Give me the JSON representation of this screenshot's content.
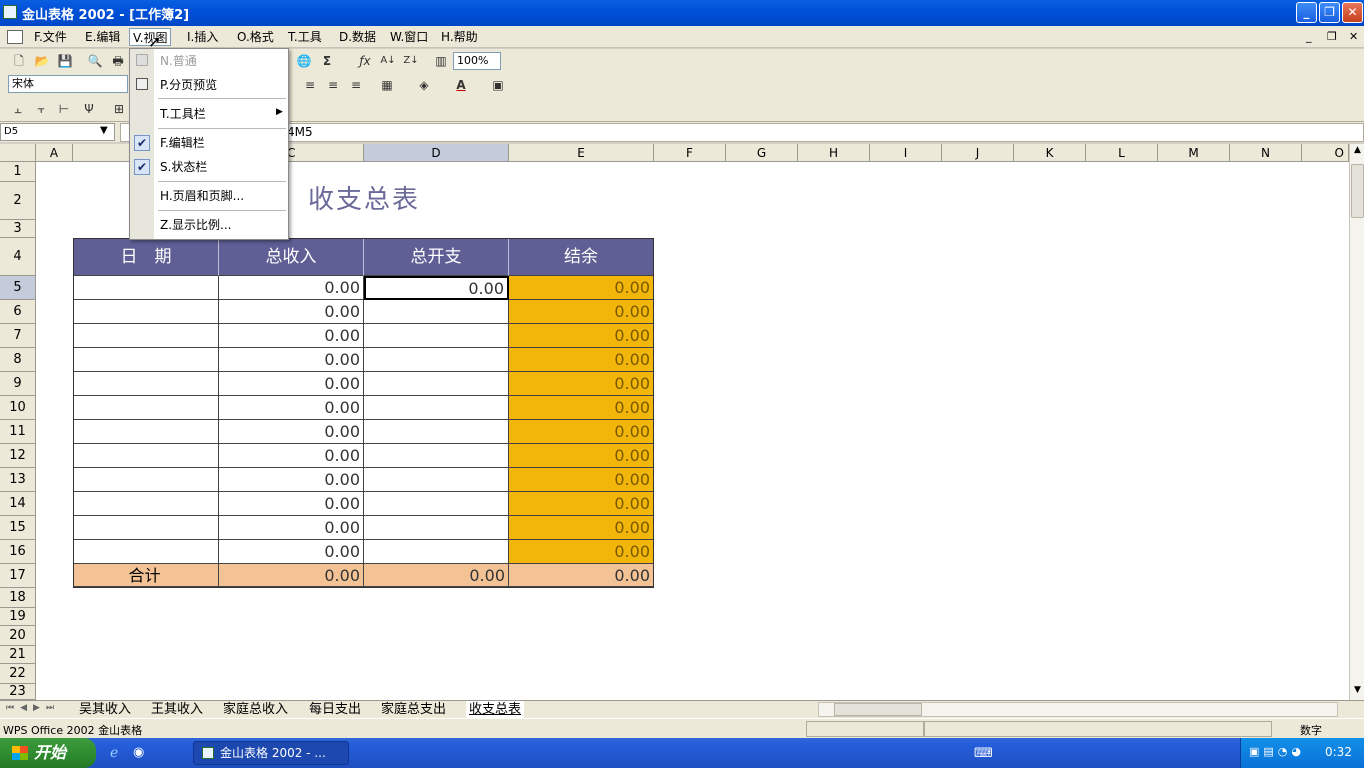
{
  "window": {
    "title": "金山表格  2002 - [工作簿2]"
  },
  "menubar": {
    "items": [
      {
        "key": "F",
        "label": "F.文件"
      },
      {
        "key": "E",
        "label": "E.编辑"
      },
      {
        "key": "V",
        "label": "V.视图"
      },
      {
        "key": "I",
        "label": "I.插入"
      },
      {
        "key": "O",
        "label": "O.格式"
      },
      {
        "key": "T",
        "label": "T.工具"
      },
      {
        "key": "D",
        "label": "D.数据"
      },
      {
        "key": "W",
        "label": "W.窗口"
      },
      {
        "key": "H",
        "label": "H.帮助"
      }
    ]
  },
  "toolbar": {
    "zoom": "100%",
    "font_name": "宋体"
  },
  "formula_bar": {
    "name_box": "D5",
    "formula": "4M5"
  },
  "view_menu": {
    "items": [
      {
        "label": "N.普通",
        "disabled": true
      },
      {
        "label": "P.分页预览"
      },
      {
        "label": "T.工具栏",
        "submenu": true
      },
      {
        "label": "F.编辑栏",
        "checked": true
      },
      {
        "label": "S.状态栏",
        "checked": true
      },
      {
        "label": "H.页眉和页脚..."
      },
      {
        "label": "Z.显示比例..."
      }
    ]
  },
  "sheet": {
    "columns": [
      "A",
      "C",
      "D",
      "E",
      "F",
      "G",
      "H",
      "I",
      "J",
      "K",
      "L",
      "M",
      "N",
      "O"
    ],
    "rows": [
      "1",
      "2",
      "3",
      "4",
      "5",
      "6",
      "7",
      "8",
      "9",
      "10",
      "11",
      "12",
      "13",
      "14",
      "15",
      "16",
      "17",
      "18",
      "19",
      "20",
      "21",
      "22",
      "23"
    ],
    "selected_cell": "D5",
    "title": "收支总表",
    "headers": [
      "日　期",
      "总收入",
      "总开支",
      "结余"
    ],
    "data_rows": [
      {
        "income": "0.00",
        "expense": "0.00",
        "balance": "0.00"
      },
      {
        "income": "0.00",
        "expense": "",
        "balance": "0.00"
      },
      {
        "income": "0.00",
        "expense": "",
        "balance": "0.00"
      },
      {
        "income": "0.00",
        "expense": "",
        "balance": "0.00"
      },
      {
        "income": "0.00",
        "expense": "",
        "balance": "0.00"
      },
      {
        "income": "0.00",
        "expense": "",
        "balance": "0.00"
      },
      {
        "income": "0.00",
        "expense": "",
        "balance": "0.00"
      },
      {
        "income": "0.00",
        "expense": "",
        "balance": "0.00"
      },
      {
        "income": "0.00",
        "expense": "",
        "balance": "0.00"
      },
      {
        "income": "0.00",
        "expense": "",
        "balance": "0.00"
      },
      {
        "income": "0.00",
        "expense": "",
        "balance": "0.00"
      },
      {
        "income": "0.00",
        "expense": "",
        "balance": "0.00"
      }
    ],
    "total_row": {
      "label": "合计",
      "income": "0.00",
      "expense": "0.00",
      "balance": "0.00"
    },
    "header_color": "#5f5f96",
    "balance_color": "#f2b60a",
    "total_color": "#f3c396"
  },
  "sheet_tabs": {
    "tabs": [
      "吴其收入",
      "王其收入",
      "家庭总收入",
      "每日支出",
      "家庭总支出",
      "收支总表"
    ],
    "active": "收支总表"
  },
  "statusbar": {
    "left": "WPS Office 2002 金山表格",
    "mode": "数字"
  },
  "taskbar": {
    "start": "开始",
    "task": "金山表格 2002 - ...",
    "clock": "0:32"
  }
}
